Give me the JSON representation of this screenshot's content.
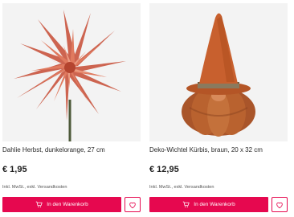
{
  "products": [
    {
      "title": "Dahlie Herbst, dunkelorange, 27 cm",
      "price": "€ 1,95",
      "shipping_note": "Inkl. MwSt., exkl. Versandkosten",
      "cart_label": "In den Warenkorb",
      "image_icon": "dahlia-flower-image"
    },
    {
      "title": "Deko-Wichtel Kürbis, braun, 20 x 32 cm",
      "price": "€ 12,95",
      "shipping_note": "Inkl. MwSt., exkl. Versandkosten",
      "cart_label": "In den Warenkorb",
      "image_icon": "pumpkin-gnome-image"
    }
  ],
  "colors": {
    "accent": "#e6084f",
    "image_bg": "#f3f3f3",
    "flower": "#d9674c",
    "gnome_hat": "#c8602e",
    "pumpkin": "#b9622f"
  }
}
